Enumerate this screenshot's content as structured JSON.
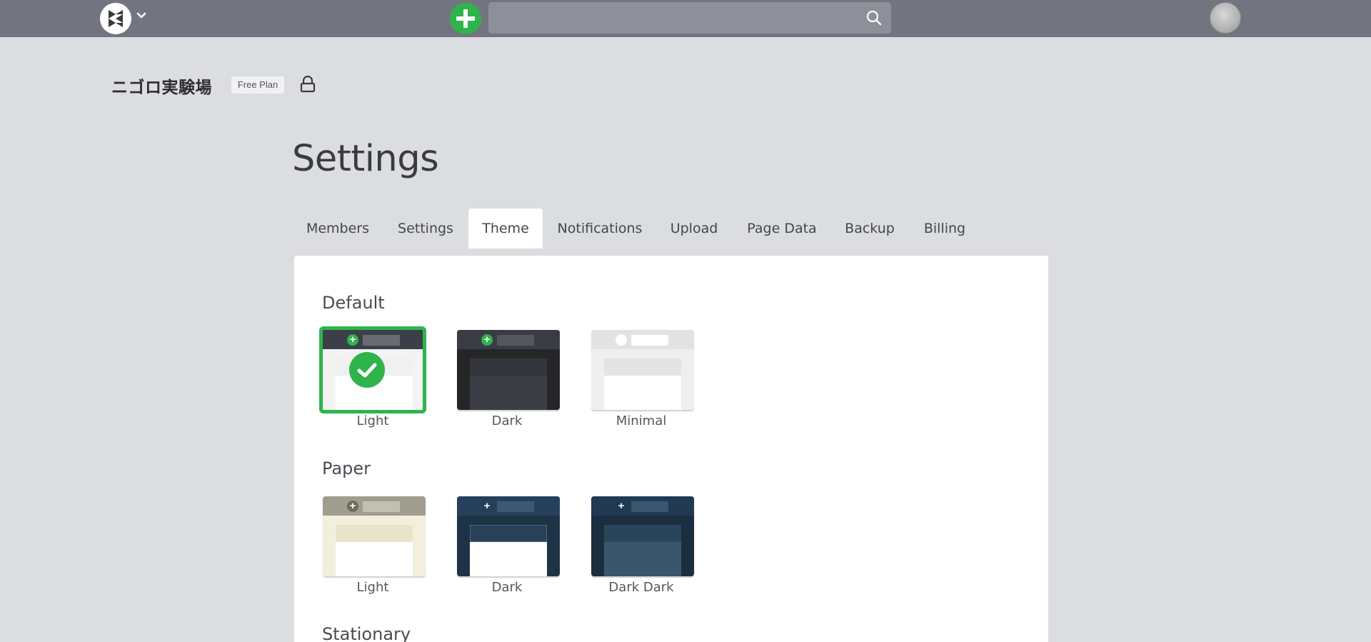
{
  "topbar": {
    "logo_icon": "app-logo-icon",
    "menu_caret_icon": "chevron-down-icon",
    "new_page_icon": "plus-icon",
    "search_placeholder": "",
    "search_icon": "search-icon",
    "avatar_icon": "user-avatar"
  },
  "project": {
    "name": "ニゴロ実験場",
    "plan": "Free Plan",
    "lock_icon": "lock-icon"
  },
  "page_title": "Settings",
  "tabs": [
    {
      "label": "Members"
    },
    {
      "label": "Settings"
    },
    {
      "label": "Theme",
      "active": true
    },
    {
      "label": "Notifications"
    },
    {
      "label": "Upload"
    },
    {
      "label": "Page Data"
    },
    {
      "label": "Backup"
    },
    {
      "label": "Billing"
    }
  ],
  "sections": [
    {
      "title": "Default",
      "themes": [
        {
          "label": "Light",
          "selected": true
        },
        {
          "label": "Dark"
        },
        {
          "label": "Minimal"
        }
      ]
    },
    {
      "title": "Paper",
      "themes": [
        {
          "label": "Light"
        },
        {
          "label": "Dark"
        },
        {
          "label": "Dark Dark"
        }
      ]
    },
    {
      "title": "Stationary",
      "themes": []
    }
  ],
  "colors": {
    "topbar": "#72757f",
    "accent_green": "#2fb44c",
    "page_bg": "#dcdde1",
    "panel_bg": "#ffffff"
  }
}
